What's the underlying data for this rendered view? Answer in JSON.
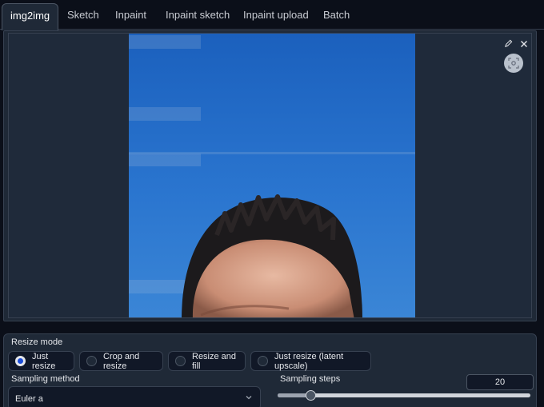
{
  "tabs": [
    {
      "label": "img2img",
      "active": true
    },
    {
      "label": "Sketch"
    },
    {
      "label": "Inpaint"
    },
    {
      "label": "Inpaint sketch"
    },
    {
      "label": "Inpaint upload"
    },
    {
      "label": "Batch"
    }
  ],
  "image_panel": {
    "tools": [
      "pencil-icon",
      "close-icon",
      "camera-capture-icon"
    ]
  },
  "resize_mode": {
    "label": "Resize mode",
    "options": [
      "Just resize",
      "Crop and resize",
      "Resize and fill",
      "Just resize (latent upscale)"
    ],
    "selected": "Just resize"
  },
  "sampling_method": {
    "label": "Sampling method",
    "value": "Euler a"
  },
  "sampling_steps": {
    "label": "Sampling steps",
    "value": "20",
    "min": 1,
    "max": 150,
    "slider_fraction": 0.13
  },
  "colors": {
    "accent": "#1d4ed8",
    "background": "#0b0f19",
    "panel": "#1f2937"
  }
}
